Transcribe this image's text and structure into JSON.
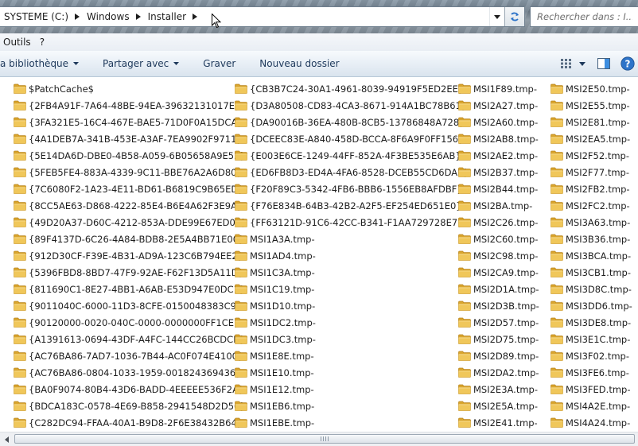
{
  "address": {
    "crumbs": [
      "SYSTEME (C:)",
      "Windows",
      "Installer"
    ]
  },
  "search": {
    "placeholder": "Rechercher dans : I..."
  },
  "menu": {
    "items": [
      "Outils",
      "?"
    ]
  },
  "commands": {
    "library": "a bibliothèque",
    "share": "Partager avec",
    "burn": "Graver",
    "new_folder": "Nouveau dossier"
  },
  "files": {
    "col1": [
      "$PatchCache$",
      "{2FB4A91F-7A64-48BE-94EA-39632131017E}",
      "{3FA321E5-16C4-467E-BAE5-71D0F0A15DCA}",
      "{4A1DEB7A-341B-453E-A3AF-7EA9902F9711}",
      "{5E14DA6D-DBE0-4B58-A059-6B05658A9E52}",
      "{5FEB5FE4-883A-4339-9C11-BBE76A2A6D80}",
      "{7C6080F2-1A23-4E11-BD61-B6819C9B65ED}",
      "{8CC5AE63-D868-4222-85E4-B6E4A62F3E9A}",
      "{49D20A37-D60C-4212-853A-DDE99E67ED02}",
      "{89F4137D-6C26-4A84-BDB8-2E5A4BB71E00}",
      "{912D30CF-F39E-4B31-AD9A-123C6B794EE2}",
      "{5396FBD8-8BD7-47F9-92AE-F62F13D5A11D}",
      "{811690C1-8E27-4BB1-A6AB-E53D947E0DC1}",
      "{9011040C-6000-11D3-8CFE-0150048383C9}",
      "{90120000-0020-040C-0000-0000000FF1CE}",
      "{A1391613-0694-43DF-A4FC-144CC26BCDCB}",
      "{AC76BA86-7AD7-1036-7B44-AC0F074E4100}",
      "{AC76BA86-0804-1033-1959-001824369436}",
      "{BA0F9074-80B4-43D6-BADD-4EEEEE536F2A}",
      "{BDCA183C-0578-4E69-B858-2941548D2D56}",
      "{C282DC94-FFAA-40A1-B9D8-2F6E38432B64}"
    ],
    "col2": [
      "{CB3B7C24-30A1-4961-8039-94919F5ED2EE}",
      "{D3A80508-CD83-4CA3-8671-914A1BC78B61}",
      "{DA90016B-36EA-480B-8CB5-13786848A728}",
      "{DCEEC83E-A840-458D-BCCA-8F6A9F0FF156}",
      "{E003E6CE-1249-44FF-852A-4F3BE535E6AB}",
      "{ED6FB8D3-ED4A-4FA6-8528-DCEB55CD6DAE}",
      "{F20F89C3-5342-4FB6-BBB6-1556EB8AFDBF}",
      "{F76E834B-64B3-42B2-A2F5-EF254ED651E0}",
      "{FF63121D-91C6-42CC-B341-F1AA729728E7}",
      "MSI1A3A.tmp-",
      "MSI1AD4.tmp-",
      "MSI1C3A.tmp-",
      "MSI1C19.tmp-",
      "MSI1D10.tmp-",
      "MSI1DC2.tmp-",
      "MSI1DC3.tmp-",
      "MSI1E8E.tmp-",
      "MSI1E10.tmp-",
      "MSI1E12.tmp-",
      "MSI1EB6.tmp-",
      "MSI1EBE.tmp-"
    ],
    "col3": [
      "MSI1F89.tmp-",
      "MSI2A27.tmp-",
      "MSI2A60.tmp-",
      "MSI2AB8.tmp-",
      "MSI2AE2.tmp-",
      "MSI2B37.tmp-",
      "MSI2B44.tmp-",
      "MSI2BA.tmp-",
      "MSI2C26.tmp-",
      "MSI2C60.tmp-",
      "MSI2C98.tmp-",
      "MSI2CA9.tmp-",
      "MSI2D1A.tmp-",
      "MSI2D3B.tmp-",
      "MSI2D57.tmp-",
      "MSI2D75.tmp-",
      "MSI2D89.tmp-",
      "MSI2DA2.tmp-",
      "MSI2E3A.tmp-",
      "MSI2E5A.tmp-",
      "MSI2E41.tmp-"
    ],
    "col4": [
      "MSI2E50.tmp-",
      "MSI2E55.tmp-",
      "MSI2E81.tmp-",
      "MSI2EA5.tmp-",
      "MSI2F52.tmp-",
      "MSI2F77.tmp-",
      "MSI2FB2.tmp-",
      "MSI2FC2.tmp-",
      "MSI3A63.tmp-",
      "MSI3B36.tmp-",
      "MSI3BCA.tmp-",
      "MSI3CB1.tmp-",
      "MSI3D8C.tmp-",
      "MSI3DD6.tmp-",
      "MSI3DE8.tmp-",
      "MSI3E1C.tmp-",
      "MSI3F02.tmp-",
      "MSI3FE6.tmp-",
      "MSI3FED.tmp-",
      "MSI4A2E.tmp-",
      "MSI4A24.tmp-"
    ]
  },
  "colors": {
    "folder": "#e8b743",
    "command_text": "#1e395b",
    "help": "#2e74c9"
  }
}
